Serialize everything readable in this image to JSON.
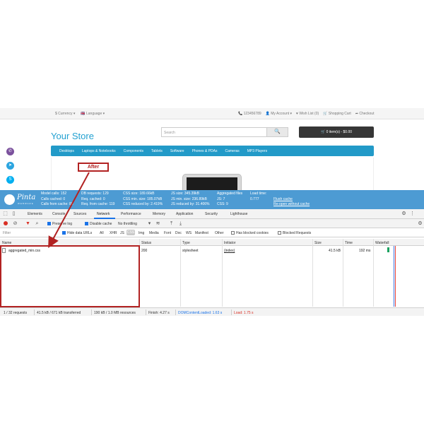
{
  "topbar": {
    "currency": "$ Currency ▾",
    "language": "🇬🇧 Language ▾",
    "phone": "📞 123456789",
    "my_account": "👤 My Account ▾",
    "wishlist": "♥ Wish List (0)",
    "shopping_cart": "🛒 Shopping Cart",
    "checkout": "➦ Checkout"
  },
  "header": {
    "store_title": "Your Store",
    "search_placeholder": "Search",
    "search_icon": "🔍",
    "cart_label": "🛒 0 item(s) - $0.00"
  },
  "nav": {
    "items": [
      "Desktops",
      "Laptops & Notebooks",
      "Components",
      "Tablets",
      "Software",
      "Phones & PDAs",
      "Cameras",
      "MP3 Players"
    ]
  },
  "annotation": {
    "after_label": "After",
    "color": "#b22222"
  },
  "profiler": {
    "logo_text": "Pinta",
    "logo_sub": "WEBWARE",
    "col1": [
      "Model calls: 152",
      "Calls cached: 0",
      "Calls from cache: 86"
    ],
    "col2": [
      "DB requests: 129",
      "Req. cached: 0",
      "Req. from cache: 119"
    ],
    "col3": [
      "CSS size: 189.66kB",
      "CSS min. size: 185.07kB",
      "CSS reduced by: 2.419%"
    ],
    "col4": [
      "JS size: 345.39kB",
      "JS min. size: 236.89kB",
      "JS reduced by: 31.406%"
    ],
    "col5": [
      "Aggregated files",
      "JS: 7",
      "CSS: 9"
    ],
    "col6_label": "Load time:",
    "col6_value": "0.777",
    "flush_cache": "Flush cache",
    "reopen": "Re-open without cache"
  },
  "devtools": {
    "tabs": [
      "Elements",
      "Console",
      "Sources",
      "Network",
      "Performance",
      "Memory",
      "Application",
      "Security",
      "Lighthouse"
    ],
    "active_tab": "Network",
    "toolbar": {
      "preserve_log": "Preserve log",
      "disable_cache": "Disable cache",
      "throttling": "No throttling"
    },
    "filter": {
      "placeholder": "Filter",
      "hide_data_urls": "Hide data URLs",
      "types": [
        "All",
        "XHR",
        "JS",
        "CSS",
        "Img",
        "Media",
        "Font",
        "Doc",
        "WS",
        "Manifest",
        "Other"
      ],
      "active_type": "CSS",
      "blocked_cookies": "Has blocked cookies",
      "blocked_requests": "Blocked Requests"
    },
    "columns": [
      "Name",
      "Status",
      "Type",
      "Initiator",
      "Size",
      "Time",
      "Waterfall"
    ],
    "rows": [
      {
        "name": "aggregated_min.css",
        "status": "200",
        "type": "stylesheet",
        "initiator": "(index)",
        "size": "41.5 kB",
        "time": "192 ms"
      }
    ],
    "status_bar": {
      "requests": "1 / 32 requests",
      "transferred": "41.5 kB / 671 kB transferred",
      "resources": "190 kB / 1.0 MB resources",
      "finish": "Finish: 4.27 s",
      "dcl": "DOMContentLoaded: 1.63 s",
      "load": "Load: 1.75 s"
    }
  },
  "colors": {
    "store_blue": "#229ac8",
    "profiler_blue": "#4d9bd3",
    "dcl": "#1a73e8",
    "load": "#d93025"
  }
}
